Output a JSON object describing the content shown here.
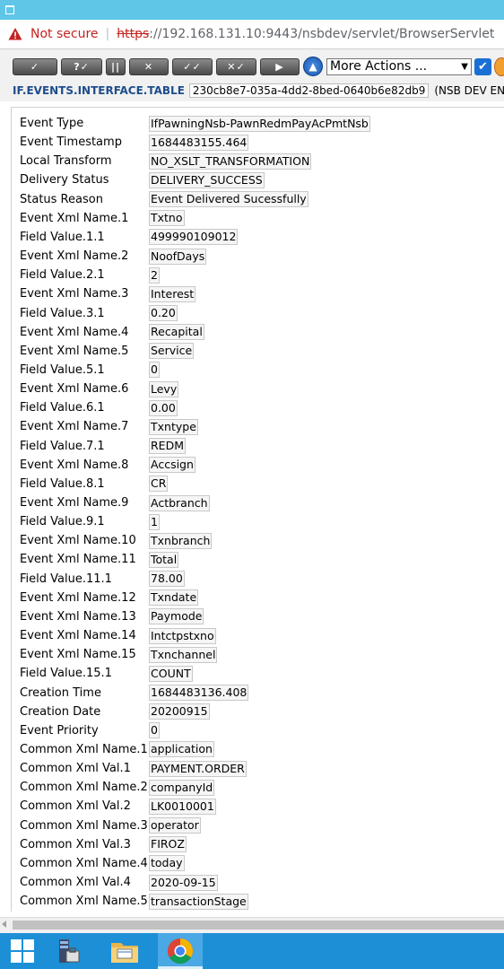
{
  "browser": {
    "security_label": "Not secure",
    "url_scheme": "https",
    "url_rest": "://192.168.131.10:9443/nsbdev/servlet/BrowserServlet"
  },
  "toolbar": {
    "buttons": [
      "✓",
      "?✓",
      "||",
      "✕",
      "✓✓",
      "✕✓",
      "▶"
    ],
    "more_actions": "More Actions ...",
    "table_name": "IF.EVENTS.INTERFACE.TABLE",
    "record_id": "230cb8e7-035a-4dd2-8bed-0640b6e82db9",
    "environment": "(NSB DEV ENV"
  },
  "fields": [
    {
      "label": "Event Type",
      "value": "IfPawningNsb-PawnRedmPayAcPmtNsb"
    },
    {
      "label": "Event Timestamp",
      "value": "1684483155.464"
    },
    {
      "label": "Local Transform",
      "value": "NO_XSLT_TRANSFORMATION"
    },
    {
      "label": "Delivery Status",
      "value": "DELIVERY_SUCCESS"
    },
    {
      "label": "Status Reason",
      "value": "Event Delivered Sucessfully"
    },
    {
      "label": "Event Xml Name.1",
      "value": "Txtno"
    },
    {
      "label": "Field Value.1.1",
      "value": "499990109012"
    },
    {
      "label": "Event Xml Name.2",
      "value": "NoofDays"
    },
    {
      "label": "Field Value.2.1",
      "value": "2"
    },
    {
      "label": "Event Xml Name.3",
      "value": "Interest"
    },
    {
      "label": "Field Value.3.1",
      "value": "0.20"
    },
    {
      "label": "Event Xml Name.4",
      "value": "Recapital"
    },
    {
      "label": "Event Xml Name.5",
      "value": "Service"
    },
    {
      "label": "Field Value.5.1",
      "value": "0"
    },
    {
      "label": "Event Xml Name.6",
      "value": "Levy"
    },
    {
      "label": "Field Value.6.1",
      "value": "0.00"
    },
    {
      "label": "Event Xml Name.7",
      "value": "Txntype"
    },
    {
      "label": "Field Value.7.1",
      "value": "REDM"
    },
    {
      "label": "Event Xml Name.8",
      "value": "Accsign"
    },
    {
      "label": "Field Value.8.1",
      "value": "CR"
    },
    {
      "label": "Event Xml Name.9",
      "value": "Actbranch"
    },
    {
      "label": "Field Value.9.1",
      "value": "1"
    },
    {
      "label": "Event Xml Name.10",
      "value": "Txnbranch"
    },
    {
      "label": "Event Xml Name.11",
      "value": "Total"
    },
    {
      "label": "Field Value.11.1",
      "value": "78.00"
    },
    {
      "label": "Event Xml Name.12",
      "value": "Txndate"
    },
    {
      "label": "Event Xml Name.13",
      "value": "Paymode"
    },
    {
      "label": "Event Xml Name.14",
      "value": "Intctpstxno"
    },
    {
      "label": "Event Xml Name.15",
      "value": "Txnchannel"
    },
    {
      "label": "Field Value.15.1",
      "value": "COUNT"
    },
    {
      "label": "Creation Time",
      "value": "1684483136.408"
    },
    {
      "label": "Creation Date",
      "value": "20200915"
    },
    {
      "label": "Event Priority",
      "value": "0"
    },
    {
      "label": "Common Xml Name.1",
      "value": "application"
    },
    {
      "label": "Common Xml Val.1",
      "value": "PAYMENT.ORDER"
    },
    {
      "label": "Common Xml Name.2",
      "value": "companyId"
    },
    {
      "label": "Common Xml Val.2",
      "value": "LK0010001"
    },
    {
      "label": "Common Xml Name.3",
      "value": "operator"
    },
    {
      "label": "Common Xml Val.3",
      "value": "FIROZ"
    },
    {
      "label": "Common Xml Name.4",
      "value": "today"
    },
    {
      "label": "Common Xml Val.4",
      "value": "2020-09-15"
    },
    {
      "label": "Common Xml Name.5",
      "value": "transactionStage"
    }
  ],
  "taskbar": {
    "items": [
      "start-icon",
      "server-manager-icon",
      "file-explorer-icon",
      "chrome-icon"
    ]
  },
  "colors": {
    "title_bar": "#5fc6e8",
    "taskbar": "#1c8fd6",
    "table_name": "#1e4d8c",
    "warning": "#c5221f"
  }
}
